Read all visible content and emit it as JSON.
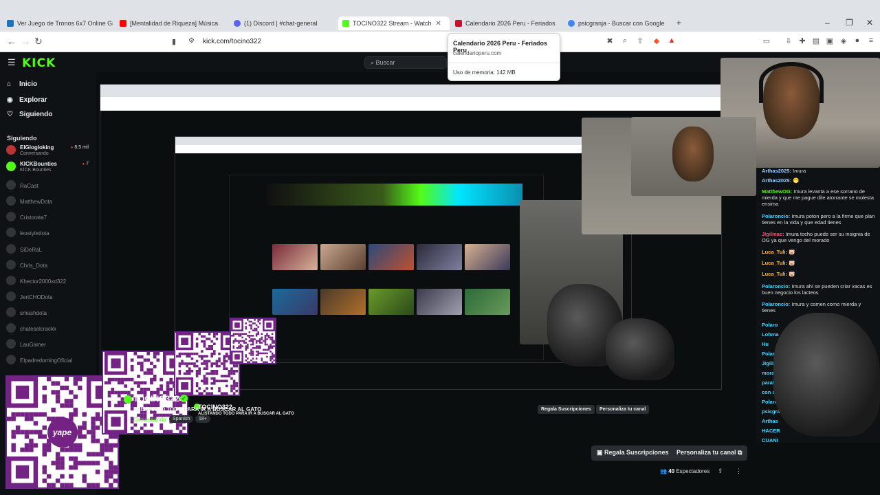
{
  "browser": {
    "tabs": [
      {
        "label": "Ver Juego de Tronos 6x7 Online Gra",
        "color": "#1e73be"
      },
      {
        "label": "[Mentalidad de Riqueza] Música",
        "color": "#ff0000"
      },
      {
        "label": "(1) Discord | #chat-general",
        "color": "#5865f2"
      },
      {
        "label": "TOCINO322 Stream - Watch",
        "color": "#53fc18"
      },
      {
        "label": "Calendario 2026 Peru - Feriados",
        "color": "#c8102e"
      },
      {
        "label": "psicgranja - Buscar con Google",
        "color": "#4285f4"
      }
    ],
    "url": "kick.com/tocino322",
    "hovercard": {
      "title": "Calendario 2026 Peru - Feriados Peru",
      "domain": "calendarioperu.com",
      "memory": "Uso de memoria: 142 MB"
    }
  },
  "kick": {
    "logo": "KICK",
    "search_placeholder": "Buscar",
    "nav": {
      "home": "Inicio",
      "explore": "Explorar",
      "following": "Siguiendo"
    },
    "following_label": "Siguiendo",
    "channels": [
      {
        "name": "ElGlogloking",
        "status": "Conversando",
        "viewers": "8,5 mil",
        "live": true
      },
      {
        "name": "KICKBounties",
        "status": "KICK Bounties",
        "viewers": "7",
        "live": true
      },
      {
        "name": "RaCast",
        "live": false
      },
      {
        "name": "MatthewDota",
        "live": false
      },
      {
        "name": "Cristorata7",
        "live": false
      },
      {
        "name": "leostyledota",
        "live": false
      },
      {
        "name": "SiDeRaL",
        "live": false
      },
      {
        "name": "Chris_Dota",
        "live": false
      },
      {
        "name": "Khector2000xd322",
        "live": false
      },
      {
        "name": "JeriCHODota",
        "live": false
      },
      {
        "name": "smashdota",
        "live": false
      },
      {
        "name": "chateselcrackk",
        "live": false
      },
      {
        "name": "LauGamer",
        "live": false
      },
      {
        "name": "ElpadredomingOficial",
        "live": false
      }
    ],
    "stream": {
      "channel": "TOCINO322",
      "title": "ALISTANDO TODO PARA IR A BUSCAR AL GATO",
      "category": "Conversando",
      "tags": [
        "Spanish",
        "18+"
      ],
      "subs_button": "Regala Suscripciones",
      "customize_button": "Personaliza tu canal",
      "viewers_count": "40",
      "viewers_label": "Espectadores"
    },
    "chat": [
      {
        "user": "Arthas2025:",
        "text": "Imura",
        "color": "#9ad0ff"
      },
      {
        "user": "Arthas2025:",
        "text": "😁",
        "color": "#9ad0ff"
      },
      {
        "user": "MatthewOG:",
        "text": "Imura levanta a ese sorrano de mierda y que me pague dile atorrante se molesta ensima",
        "color": "#53fc18"
      },
      {
        "user": "Polaroncio:",
        "text": "Imura poton pero a la firme que plan tienes en la vida y que edad tienes",
        "color": "#4bd3ff"
      },
      {
        "user": "JIgilinac:",
        "text": "Imura tocho puede ser su insignia de OG ya que vengo del morado",
        "color": "#ff4d6d"
      },
      {
        "user": "Luca_Tuli:",
        "text": "🐷",
        "color": "#ffb84d"
      },
      {
        "user": "Luca_Tuli:",
        "text": "🐷",
        "color": "#ffb84d"
      },
      {
        "user": "Luca_Tuli:",
        "text": "🐷",
        "color": "#ffb84d"
      },
      {
        "user": "Polaroncio:",
        "text": "Imura ahí se pueden criar vacas es buen negocio los lacteos",
        "color": "#4bd3ff"
      },
      {
        "user": "Polaroncio:",
        "text": "Imura y comen como mierda y tienes",
        "color": "#4bd3ff"
      }
    ],
    "chat_tail": [
      "Polaro",
      "Lohma",
      "Hu",
      "Polaro",
      "JIgili",
      "morad",
      "paraba",
      "con sm",
      "Polaro",
      "psicgra",
      "Arthas",
      "HACER",
      "CUANI"
    ]
  },
  "qr_brand": "yape"
}
